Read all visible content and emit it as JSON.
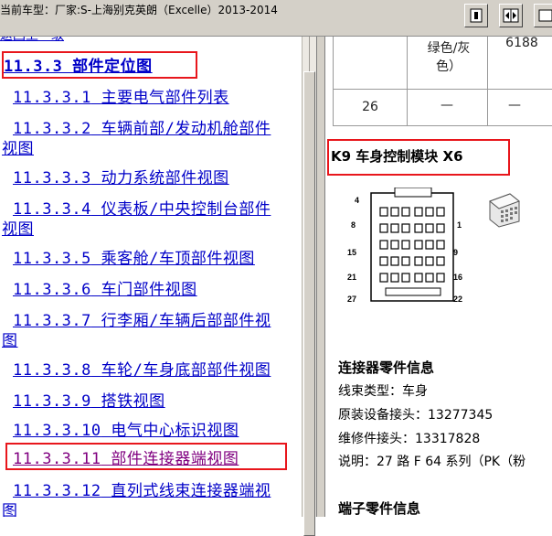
{
  "window": {
    "title": "当前车型：厂家:S-上海别克英朗（Excelle）2013-2014"
  },
  "toolbar": {
    "buttons": [
      {
        "name": "sync-toc-icon"
      },
      {
        "name": "expand-pane-icon"
      },
      {
        "name": "print-icon"
      }
    ]
  },
  "nav": {
    "back_link": "返回上一级",
    "current_section": "11.3.3 部件定位图",
    "items": [
      {
        "num": "11.3.3.1",
        "label": "主要电气部件列表",
        "visited": false
      },
      {
        "num": "11.3.3.2",
        "label": "车辆前部/发动机舱部件",
        "cont": "视图",
        "visited": false
      },
      {
        "num": "11.3.3.3",
        "label": "动力系统部件视图",
        "visited": false
      },
      {
        "num": "11.3.3.4",
        "label": "仪表板/中央控制台部件",
        "cont": "视图",
        "visited": false
      },
      {
        "num": "11.3.3.5",
        "label": "乘客舱/车顶部件视图",
        "visited": false
      },
      {
        "num": "11.3.3.6",
        "label": "车门部件视图",
        "visited": false
      },
      {
        "num": "11.3.3.7",
        "label": "行李厢/车辆后部部件视",
        "cont": "图",
        "visited": false
      },
      {
        "num": "11.3.3.8",
        "label": "车轮/车身底部部件视图",
        "visited": false
      },
      {
        "num": "11.3.3.9",
        "label": "搭铁视图",
        "visited": false
      },
      {
        "num": "11.3.3.10",
        "label": "电气中心标识视图",
        "visited": false
      },
      {
        "num": "11.3.3.11",
        "label": "部件连接器端视图",
        "visited": true
      },
      {
        "num": "11.3.3.12",
        "label": "直列式线束连接器端视",
        "cont": "图",
        "visited": false
      }
    ]
  },
  "content": {
    "table": {
      "row1": {
        "color": "绿色/灰色）",
        "color_line1": "绿色/灰",
        "color_line2": "色）",
        "code": "6188"
      },
      "row2": {
        "num": "26",
        "a": "—",
        "b": "—"
      }
    },
    "heading": "K9 车身控制模块 X6",
    "pins": {
      "p4": "4",
      "p8": "8",
      "p1": "1",
      "p15": "15",
      "p9": "9",
      "p21": "21",
      "p16": "16",
      "p27": "27",
      "p22": "22"
    },
    "connector_info_title": "连接器零件信息",
    "harness_type": "线束类型：车身",
    "oem_connector": "原装设备接头：13277345",
    "service_connector": "维修件接头：13317828",
    "description": "说明：27 路 F 64 系列（PK（粉",
    "terminal_info_title": "端子零件信息"
  },
  "colors": {
    "link": "#0000c8",
    "visited_link": "#800080",
    "highlight_box": "#e8161c",
    "chrome": "#d4d0c8"
  }
}
